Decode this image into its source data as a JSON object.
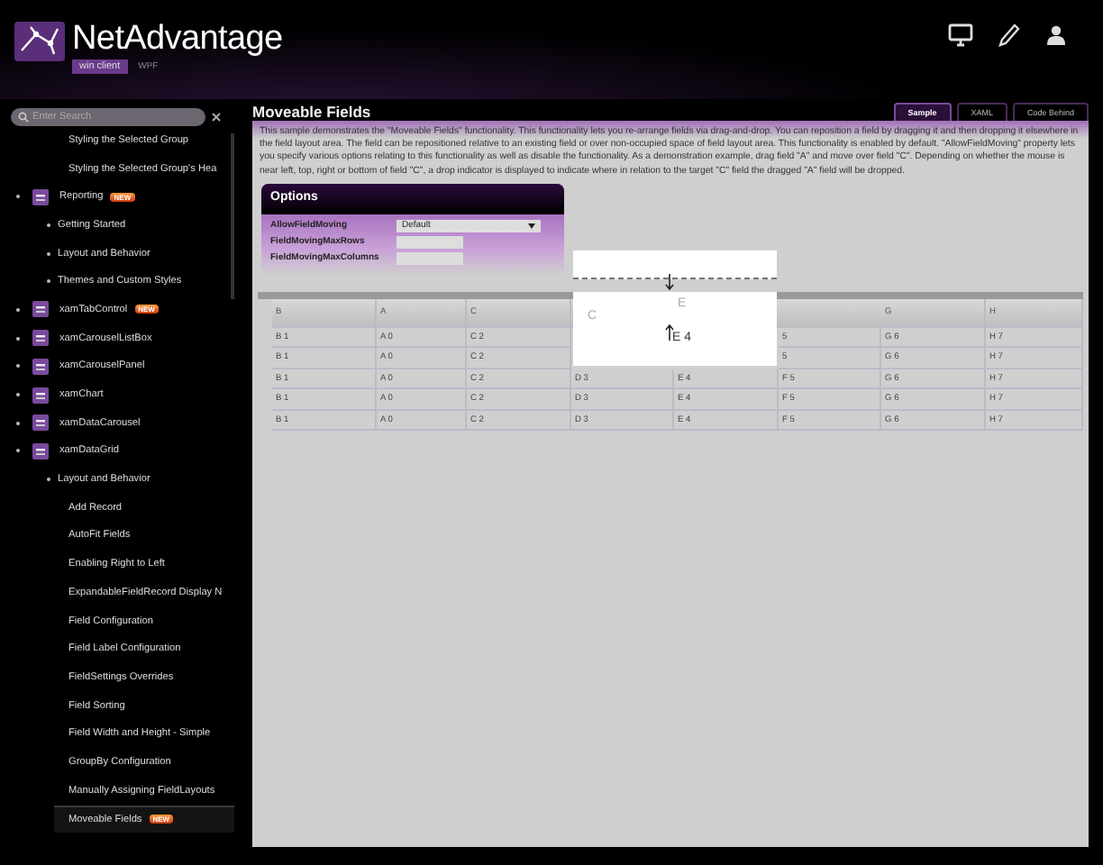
{
  "header": {
    "brand": "NetAdvantage",
    "edition": "win client",
    "version": "WPF"
  },
  "sidebar": {
    "search": {
      "placeholder": "Enter Search"
    },
    "tree": [
      {
        "children": [
          {
            "children": [
              {
                "label": "Styling the Selected Group",
                "selected": false
              },
              {
                "label": "Styling the Selected Group's Hea",
                "selected": false
              }
            ]
          }
        ]
      },
      {
        "label": "Reporting",
        "badge": "NEW",
        "selected": false,
        "children": [
          {
            "label": "Getting Started",
            "selected": false
          },
          {
            "label": "Layout and Behavior",
            "selected": false
          },
          {
            "label": "Themes and Custom Styles",
            "selected": false
          }
        ]
      },
      {
        "label": "xamTabControl",
        "badge": "NEW",
        "selected": false
      },
      {
        "label": "xamCarouselListBox",
        "selected": false
      },
      {
        "label": "xamCarouselPanel",
        "selected": false
      },
      {
        "label": "xamChart",
        "selected": false
      },
      {
        "label": "xamDataCarousel",
        "selected": false
      },
      {
        "label": "xamDataGrid",
        "selected": false,
        "children": [
          {
            "label": "Layout and Behavior",
            "selected": false,
            "children": [
              {
                "label": "Add Record",
                "selected": false
              },
              {
                "label": "AutoFit Fields",
                "selected": false
              },
              {
                "label": "Enabling Right to Left",
                "selected": false
              },
              {
                "label": "ExpandableFieldRecord Display N",
                "selected": false
              },
              {
                "label": "Field Configuration",
                "selected": false
              },
              {
                "label": "Field Label Configuration",
                "selected": false
              },
              {
                "label": "FieldSettings Overrides",
                "selected": false
              },
              {
                "label": "Field Sorting",
                "selected": false
              },
              {
                "label": "Field Width and Height - Simple",
                "selected": false
              },
              {
                "label": "GroupBy Configuration",
                "selected": false
              },
              {
                "label": "Manually Assigning FieldLayouts",
                "selected": false
              },
              {
                "label": "Moveable Fields",
                "badge": "NEW",
                "selected": true
              }
            ]
          }
        ]
      }
    ]
  },
  "page": {
    "title": "Moveable Fields",
    "tabs": [
      {
        "label": "Sample",
        "selected": true
      },
      {
        "label": "XAML",
        "selected": false
      },
      {
        "label": "Code Behind",
        "selected": false
      }
    ],
    "description": "This sample demonstrates the \"Moveable Fields\" functionality. This functionality lets you re-arrange fields via drag-and-drop. You can reposition a field by dragging it and then dropping it elsewhere in the field layout area. The field can be repositioned relative to an existing field or over non-occupied space of field layout area. This functionality is enabled by default. \"AllowFieldMoving\" property lets you specify various options relating to this functionality as well as disable the functionality. As a demonstration example, drag field \"A\" and move over field \"C\". Depending on whether the mouse is near left, top, right or bottom of field \"C\", a drop indicator is displayed to indicate where in relation to the target \"C\" field the dragged \"A\" field will be dropped.",
    "options": {
      "title": "Options",
      "fields": [
        {
          "kind": "dropdown",
          "label": "AllowFieldMoving",
          "value": "Default"
        },
        {
          "kind": "input",
          "label": "FieldMovingMaxRows"
        },
        {
          "kind": "input",
          "label": "FieldMovingMaxColumns"
        }
      ]
    },
    "grid": {
      "columns": [
        "B",
        "A",
        "C",
        null,
        null,
        null,
        "G",
        "H"
      ],
      "rows": [
        {
          "cells": [
            "B 1",
            "A 0",
            "C 2",
            null,
            null,
            "5",
            "G 6",
            "H 7"
          ]
        },
        {
          "cells": [
            "B 1",
            "A 0",
            "C 2",
            null,
            null,
            "5",
            "G 6",
            "H 7"
          ]
        },
        {
          "cells": [
            "B 1",
            "A 0",
            "C 2",
            "D 3",
            "E 4",
            "F 5",
            "G 6",
            "H 7"
          ]
        },
        {
          "cells": [
            "B 1",
            "A 0",
            "C 2",
            "D 3",
            "E 4",
            "F 5",
            "G 6",
            "H 7"
          ]
        },
        {
          "cells": [
            "B 1",
            "A 0",
            "C 2",
            "D 3",
            "E 4",
            "F 5",
            "G 6",
            "H 7"
          ]
        }
      ]
    },
    "drag_overlay": {
      "ghost_headers": [
        "C",
        "E"
      ],
      "cell": "E 4"
    }
  }
}
